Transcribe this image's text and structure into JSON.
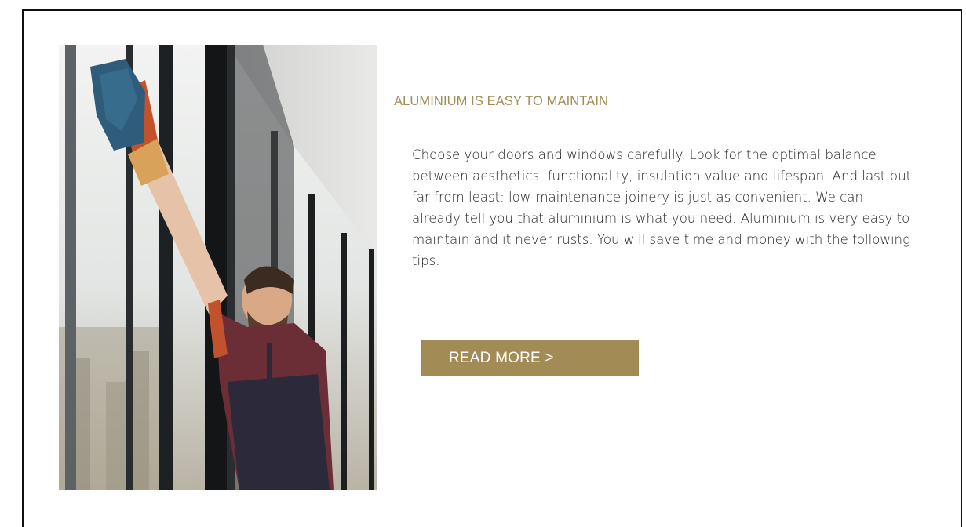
{
  "feature": {
    "image_alt": "Man in an apron cleaning a tall aluminium window with a blue cloth and orange gloves",
    "heading": "ALUMINIUM IS EASY TO MAINTAIN",
    "body": "Choose your doors and windows carefully. Look for the optimal balance between aesthetics, functionality, insulation value and lifespan. And last but far from least: low-maintenance joinery is just as convenient. We can already tell you that aluminium is what you need. Aluminium is very easy to maintain and it never rusts. You will save time and money with the following tips.",
    "button_label": "READ MORE >"
  },
  "colors": {
    "accent": "#a28b55",
    "border": "#111111",
    "text": "#222222",
    "background": "#ffffff"
  }
}
